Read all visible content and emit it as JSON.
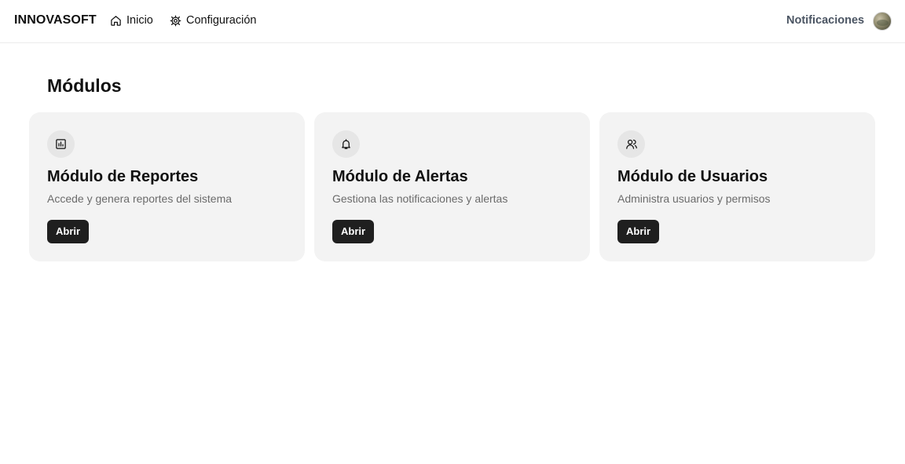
{
  "header": {
    "brand": "INNOVASOFT",
    "nav": [
      {
        "label": "Inicio",
        "icon": "home-icon"
      },
      {
        "label": "Configuración",
        "icon": "gear-icon"
      }
    ],
    "notifications_label": "Notificaciones",
    "avatar_icon": "user-avatar"
  },
  "main": {
    "title": "Módulos",
    "cards": [
      {
        "icon": "bar-chart-icon",
        "title": "Módulo de Reportes",
        "description": "Accede y genera reportes del sistema",
        "button": "Abrir"
      },
      {
        "icon": "bell-icon",
        "title": "Módulo de Alertas",
        "description": "Gestiona las notificaciones y alertas",
        "button": "Abrir"
      },
      {
        "icon": "users-icon",
        "title": "Módulo de Usuarios",
        "description": "Administra usuarios y permisos",
        "button": "Abrir"
      }
    ]
  },
  "colors": {
    "card_background": "#f3f3f3",
    "button_background": "#1f1f1f",
    "muted_text": "#6b6b6b"
  }
}
